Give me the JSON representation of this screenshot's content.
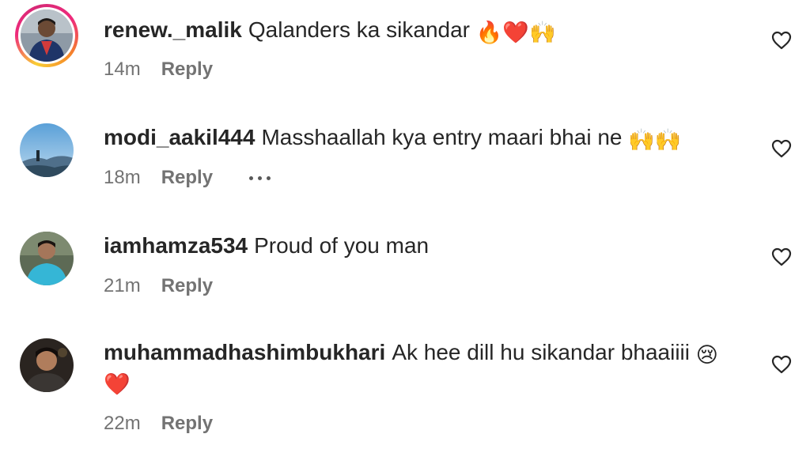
{
  "comments": [
    {
      "username": "renew._malik",
      "text": "Qalanders ka sikandar",
      "emojis": "🔥❤️🙌",
      "time": "14m",
      "reply": "Reply"
    },
    {
      "username": "modi_aakil444",
      "text": "Masshaallah kya entry maari bhai ne",
      "emojis": "🙌🙌",
      "time": "18m",
      "reply": "Reply"
    },
    {
      "username": "iamhamza534",
      "text": "Proud of you man",
      "emojis": "",
      "time": "21m",
      "reply": "Reply"
    },
    {
      "username": "muhammadhashimbukhari",
      "text": "Ak hee dill hu sikandar bhaaiiii",
      "emojis": "😢",
      "emojis2": "❤️",
      "time": "22m",
      "reply": "Reply"
    }
  ],
  "icons": {
    "like": "heart-outline-icon",
    "more": "more-dots-icon"
  },
  "colors": {
    "text": "#262626",
    "meta": "#737373",
    "story_ring_start": "#f9ce34",
    "story_ring_end": "#ee2a7b"
  }
}
